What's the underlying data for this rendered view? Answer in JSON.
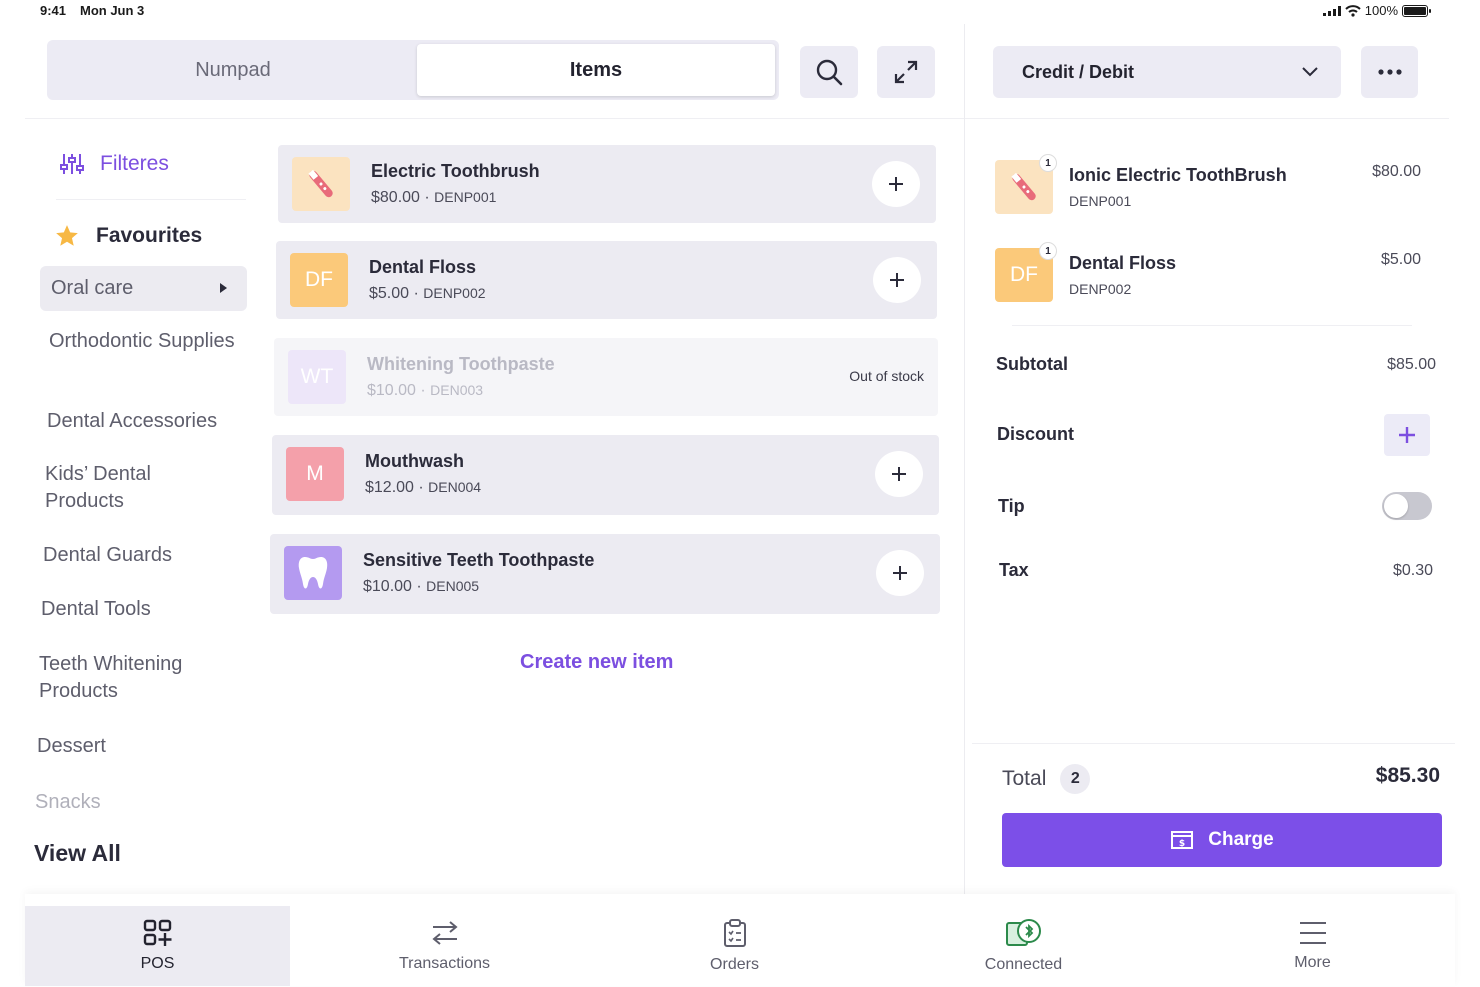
{
  "status_bar": {
    "time": "9:41",
    "date": "Mon Jun 3",
    "battery": "100%"
  },
  "tabs": {
    "numpad": "Numpad",
    "items": "Items"
  },
  "sidebar": {
    "filters_label": "Filteres",
    "favourites_label": "Favourites",
    "selected_category": "Oral care",
    "categories": [
      "Orthodontic Supplies",
      "Dental Accessories",
      "Kids’ Dental Products",
      "Dental Guards",
      "Dental Tools",
      "Teeth Whitening Products",
      "Dessert",
      "Snacks"
    ],
    "view_all": "View All"
  },
  "items": [
    {
      "name": "Electric Toothbrush",
      "price": "$80.00",
      "sku": "DENP001",
      "thumb": "toothbrush-image",
      "thumb_color": "#fbe3c0"
    },
    {
      "name": "Dental Floss",
      "price": "$5.00",
      "sku": "DENP002",
      "thumb_text": "DF",
      "thumb_color": "#fbc97a"
    },
    {
      "name": "Whitening Toothpaste",
      "price": "$10.00",
      "sku": "DEN003",
      "thumb_text": "WT",
      "thumb_color": "#e6dcf7",
      "status": "Out of stock"
    },
    {
      "name": "Mouthwash",
      "price": "$12.00",
      "sku": "DEN004",
      "thumb_text": "M",
      "thumb_color": "#f4a0aa"
    },
    {
      "name": "Sensitive Teeth Toothpaste",
      "price": "$10.00",
      "sku": "DEN005",
      "thumb": "tooth-icon",
      "thumb_color": "#b49af0"
    }
  ],
  "create_item": "Create new item",
  "payment": {
    "method": "Credit / Debit"
  },
  "cart": {
    "lines": [
      {
        "name": "Ionic Electric ToothBrush",
        "sku": "DENP001",
        "price": "$80.00",
        "qty": "1"
      },
      {
        "name": "Dental Floss",
        "sku": "DENP002",
        "price": "$5.00",
        "qty": "1",
        "thumb_text": "DF"
      }
    ],
    "subtotal_label": "Subtotal",
    "subtotal": "$85.00",
    "discount_label": "Discount",
    "tip_label": "Tip",
    "tip_enabled": false,
    "tax_label": "Tax",
    "tax": "$0.30",
    "total_label": "Total",
    "item_count": "2",
    "total": "$85.30",
    "charge_label": "Charge"
  },
  "bottom_nav": [
    {
      "label": "POS",
      "icon": "grid-plus-icon",
      "active": true
    },
    {
      "label": "Transactions",
      "icon": "arrows-swap-icon"
    },
    {
      "label": "Orders",
      "icon": "clipboard-icon"
    },
    {
      "label": "Connected",
      "icon": "connected-icon"
    },
    {
      "label": "More",
      "icon": "menu-icon"
    }
  ],
  "colors": {
    "accent": "#7c4fe8",
    "panel": "#ecebf2"
  }
}
